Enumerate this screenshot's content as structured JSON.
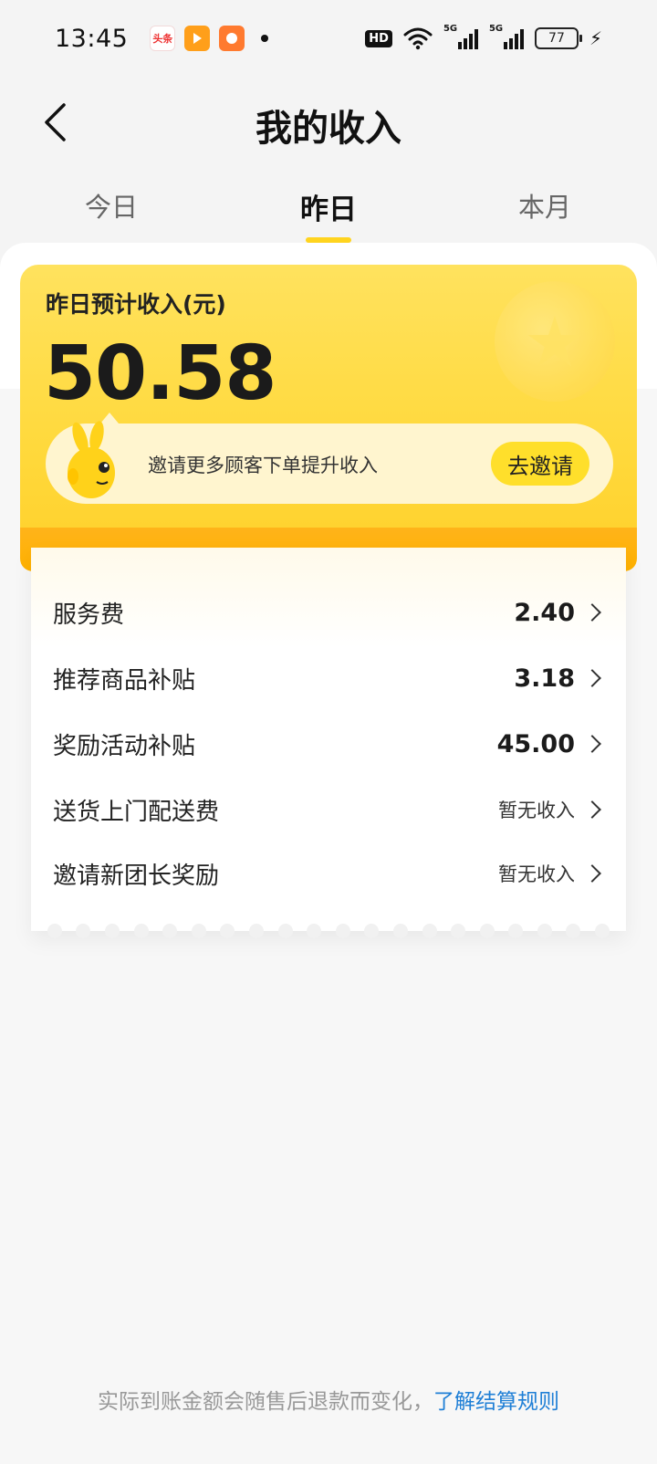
{
  "status_bar": {
    "time": "13:45",
    "app_icons": [
      "toutiao-icon",
      "video-icon",
      "mall-icon"
    ],
    "toutiao_label": "头条",
    "hd_label": "HD",
    "network_1": "5G",
    "network_2": "5G",
    "battery": "77"
  },
  "header": {
    "title": "我的收入"
  },
  "tabs": [
    {
      "label": "今日",
      "active": false
    },
    {
      "label": "昨日",
      "active": true
    },
    {
      "label": "本月",
      "active": false
    }
  ],
  "income_card": {
    "label": "昨日预计收入(元)",
    "amount": "50.58",
    "invite_text": "邀请更多顾客下单提升收入",
    "invite_button": "去邀请"
  },
  "details": [
    {
      "label": "服务费",
      "value": "2.40",
      "has_income": true
    },
    {
      "label": "推荐商品补贴",
      "value": "3.18",
      "has_income": true
    },
    {
      "label": "奖励活动补贴",
      "value": "45.00",
      "has_income": true
    },
    {
      "label": "送货上门配送费",
      "value": "暂无收入",
      "has_income": false
    },
    {
      "label": "邀请新团长奖励",
      "value": "暂无收入",
      "has_income": false
    }
  ],
  "footer": {
    "note": "实际到账金额会随售后退款而变化，",
    "link": "了解结算规则"
  },
  "colors": {
    "accent_yellow": "#ffd93c",
    "orange": "#ffb200",
    "link_blue": "#1f7fd6"
  }
}
